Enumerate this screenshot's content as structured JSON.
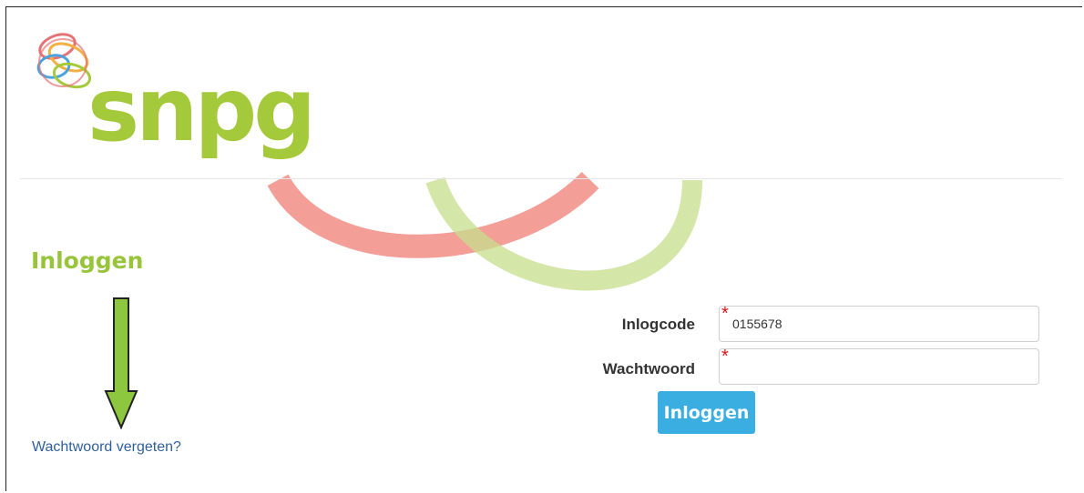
{
  "brand": {
    "name": "snpg",
    "logo_icon": "intertwined-rings-logo-icon",
    "color": "#a4c93a"
  },
  "page": {
    "title": "Inloggen",
    "title_color": "#98c43c"
  },
  "form": {
    "login_code": {
      "label": "Inlogcode",
      "value": "0155678",
      "required_marker": "*"
    },
    "password": {
      "label": "Wachtwoord",
      "value": "",
      "required_marker": "*"
    },
    "submit_label": "Inloggen",
    "submit_color": "#3aaee0"
  },
  "links": {
    "forgot_password": "Wachtwoord vergeten?"
  },
  "annotation": {
    "icon": "arrow-down-icon",
    "color": "#8dc63f"
  }
}
